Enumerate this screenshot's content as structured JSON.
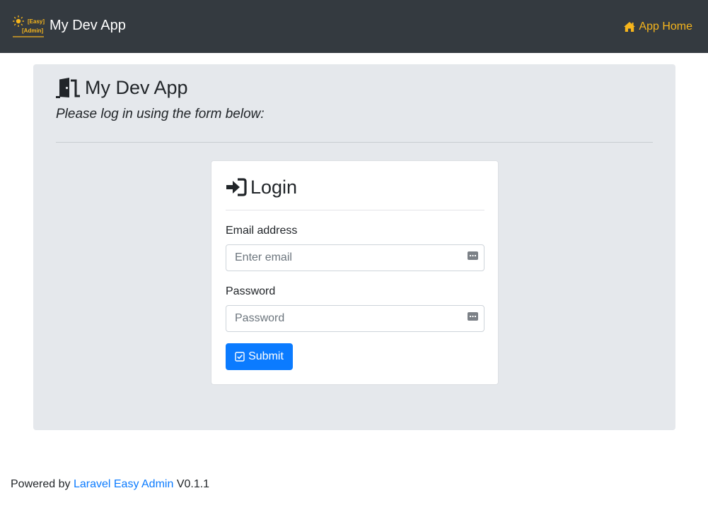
{
  "navbar": {
    "brand_name": "My Dev App",
    "logo": {
      "icon": "sun-icon",
      "line1": "[Easy]",
      "line2": "[Admin]"
    },
    "home_link": {
      "label": "App Home",
      "icon": "home-icon"
    }
  },
  "jumbotron": {
    "title": "My Dev App",
    "title_icon": "door-open-icon",
    "lead": "Please log in using the form below:"
  },
  "login": {
    "title": "Login",
    "title_icon": "sign-in-icon",
    "email": {
      "label": "Email address",
      "placeholder": "Enter email",
      "value": ""
    },
    "password": {
      "label": "Password",
      "placeholder": "Password",
      "value": ""
    },
    "submit": {
      "label": "Submit",
      "icon": "check-square-icon"
    }
  },
  "footer": {
    "prefix": "Powered by",
    "link_text": "Laravel Easy Admin",
    "version": "V0.1.1"
  },
  "colors": {
    "navbar_bg": "#343a40",
    "accent_orange": "#f6b51c",
    "primary_blue": "#0b7bff",
    "jumbotron_bg": "#e5e8ec"
  }
}
